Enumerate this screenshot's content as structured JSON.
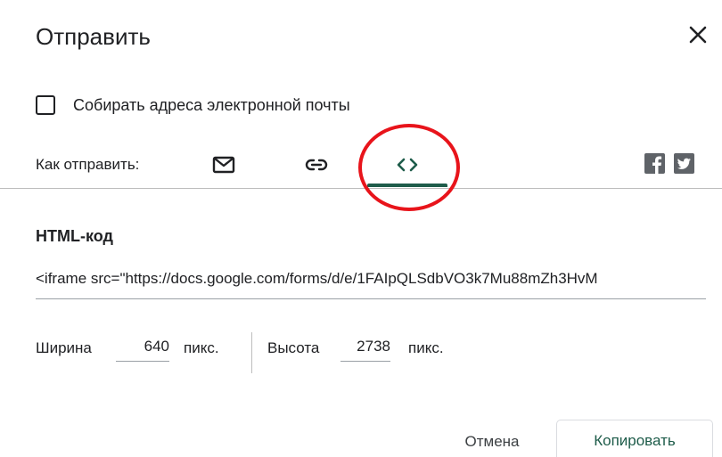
{
  "dialog": {
    "title": "Отправить",
    "close_icon": "close-icon"
  },
  "collect_emails": {
    "label": "Собирать адреса электронной почты",
    "checked": false
  },
  "send_via": {
    "label": "Как отправить:",
    "tabs": [
      {
        "icon": "email-icon",
        "selected": false
      },
      {
        "icon": "link-icon",
        "selected": false
      },
      {
        "icon": "embed-code-icon",
        "selected": true
      }
    ],
    "social": [
      {
        "icon": "facebook-icon"
      },
      {
        "icon": "twitter-icon"
      }
    ],
    "accent_color": "#1e5c4a",
    "highlight_color": "#e8141b"
  },
  "html_code": {
    "title": "HTML-код",
    "value": "<iframe src=\"https://docs.google.com/forms/d/e/1FAIpQLSdbVO3k7Mu88mZh3HvM"
  },
  "size": {
    "width_label": "Ширина",
    "width_value": "640",
    "width_unit": "пикс.",
    "height_label": "Высота",
    "height_value": "2738",
    "height_unit": "пикс."
  },
  "actions": {
    "cancel_label": "Отмена",
    "copy_label": "Копировать"
  }
}
